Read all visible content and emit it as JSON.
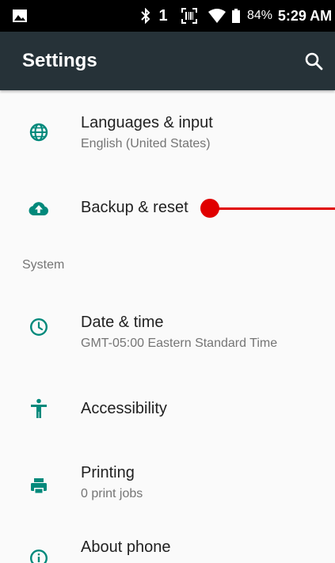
{
  "status_bar": {
    "icons": [
      "gallery-icon",
      "bluetooth-icon",
      "sim-icon",
      "barcode-icon",
      "wifi-icon",
      "battery-icon"
    ],
    "sim_label": "1",
    "battery_percent": "84%",
    "time": "5:29 AM"
  },
  "toolbar": {
    "title": "Settings",
    "search_icon": "search-icon"
  },
  "settings": {
    "languages": {
      "title": "Languages & input",
      "summary": "English (United States)",
      "icon": "globe-icon"
    },
    "backup": {
      "title": "Backup & reset",
      "icon": "cloud-upload-icon"
    },
    "section_system": "System",
    "date_time": {
      "title": "Date & time",
      "summary": "GMT-05:00 Eastern Standard Time",
      "icon": "clock-icon"
    },
    "accessibility": {
      "title": "Accessibility",
      "icon": "accessibility-icon"
    },
    "printing": {
      "title": "Printing",
      "summary": "0 print jobs",
      "icon": "printer-icon"
    },
    "about": {
      "title": "About phone",
      "icon": "info-icon"
    }
  },
  "colors": {
    "toolbar_bg": "#263238",
    "accent": "#00897b",
    "annotation": "#e00000"
  }
}
